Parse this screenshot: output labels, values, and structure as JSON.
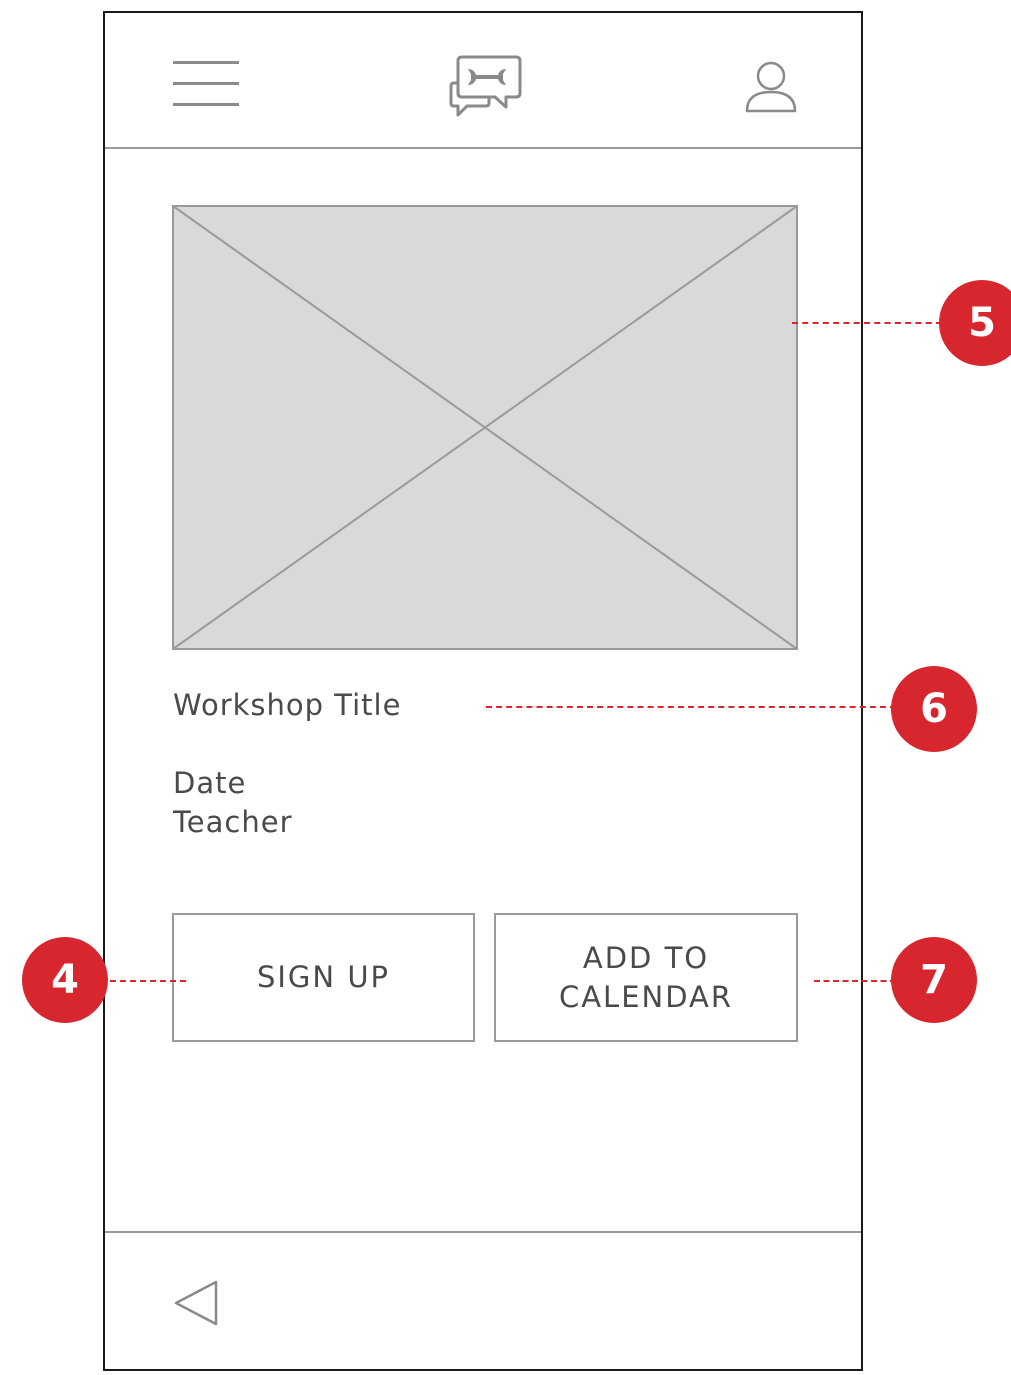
{
  "header": {
    "menu_icon": "hamburger-menu-icon",
    "logo_icon": "chat-bubbles-wrench-logo",
    "profile_icon": "user-profile-icon"
  },
  "main": {
    "image_placeholder": "image-placeholder",
    "workshop_title": "Workshop Title",
    "date_label": "Date",
    "teacher_label": "Teacher",
    "buttons": {
      "sign_up": "SIGN UP",
      "add_to_calendar": "ADD TO\nCALENDAR"
    }
  },
  "footer": {
    "back_icon": "back-triangle-icon"
  },
  "annotations": [
    {
      "number": "4",
      "target": "sign-up-button"
    },
    {
      "number": "5",
      "target": "image-placeholder"
    },
    {
      "number": "6",
      "target": "workshop-title"
    },
    {
      "number": "7",
      "target": "add-to-calendar-button"
    }
  ],
  "colors": {
    "annotation": "#d7262e",
    "frame": "#1a1a1a",
    "wire_gray": "#9a9a9a",
    "placeholder_fill": "#d9d9d9",
    "text": "#4a4a4a"
  }
}
